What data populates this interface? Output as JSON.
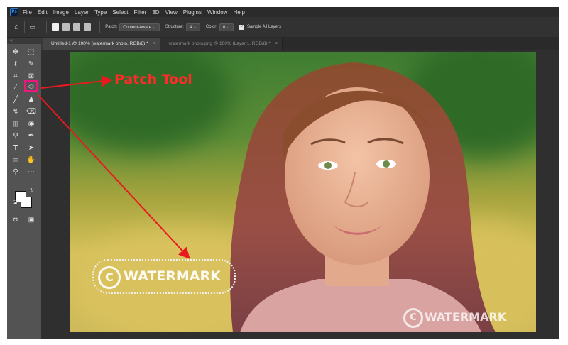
{
  "menubar": {
    "logo": "Ps",
    "items": [
      "File",
      "Edit",
      "Image",
      "Layer",
      "Type",
      "Select",
      "Filter",
      "3D",
      "View",
      "Plugins",
      "Window",
      "Help"
    ]
  },
  "options_bar": {
    "patch_label": "Patch:",
    "patch_value": "Content-Aware",
    "structure_label": "Structure:",
    "structure_value": "4",
    "color_label": "Color:",
    "color_value": "0",
    "sample_all_layers_label": "Sample All Layers",
    "sample_all_layers_checked": true
  },
  "tabs": [
    {
      "label": "Untitled-1 @ 100% (watermark photo, RGB/8) *",
      "active": true
    },
    {
      "label": "watermark photo.png @ 100% (Layer 1, RGB/8) *",
      "active": false
    }
  ],
  "annotations": {
    "patch_tool_label": "Patch Tool",
    "arrow_color": "#e8191f",
    "highlight_color": "#e8197a"
  },
  "watermarks": [
    {
      "symbol": "C",
      "text": "WATERMARK",
      "selected": true
    },
    {
      "symbol": "C",
      "text": "WATERMARK",
      "selected": false
    }
  ],
  "toolbar": {
    "tools": [
      "move-icon",
      "marquee-icon",
      "lasso-icon",
      "quick-select-icon",
      "crop-icon",
      "frame-icon",
      "eyedropper-icon",
      "patch-tool-icon",
      "brush-icon",
      "stamp-icon",
      "history-brush-icon",
      "eraser-icon",
      "gradient-icon",
      "blur-icon",
      "dodge-icon",
      "pen-icon",
      "type-icon",
      "path-select-icon",
      "rectangle-icon",
      "hand-icon",
      "zoom-icon",
      "more-tools-icon"
    ],
    "foreground_color": "#ffffff",
    "background_color": "#ffffff"
  }
}
